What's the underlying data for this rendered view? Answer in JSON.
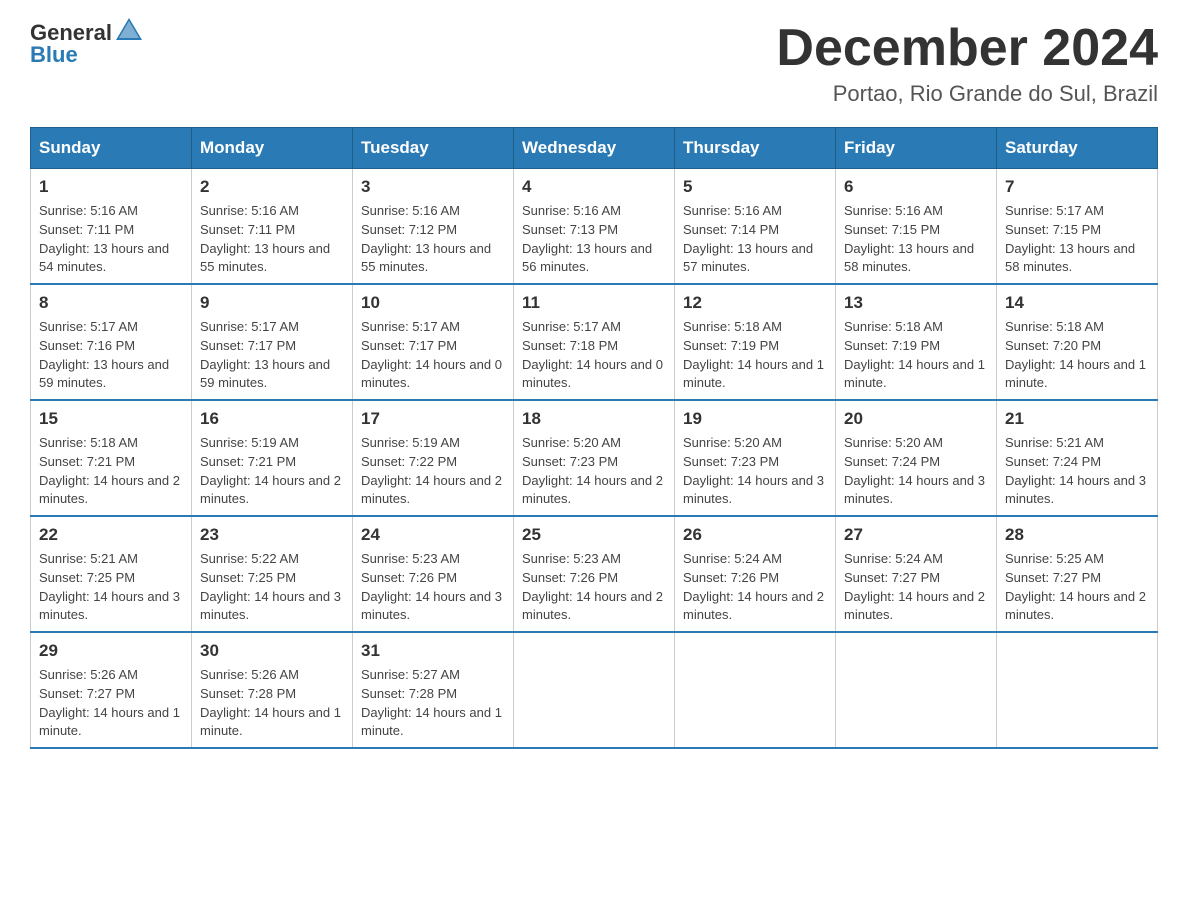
{
  "header": {
    "logo_general": "General",
    "logo_blue": "Blue",
    "title": "December 2024",
    "subtitle": "Portao, Rio Grande do Sul, Brazil"
  },
  "weekdays": [
    "Sunday",
    "Monday",
    "Tuesday",
    "Wednesday",
    "Thursday",
    "Friday",
    "Saturday"
  ],
  "weeks": [
    [
      {
        "day": "1",
        "sunrise": "5:16 AM",
        "sunset": "7:11 PM",
        "daylight": "13 hours and 54 minutes."
      },
      {
        "day": "2",
        "sunrise": "5:16 AM",
        "sunset": "7:11 PM",
        "daylight": "13 hours and 55 minutes."
      },
      {
        "day": "3",
        "sunrise": "5:16 AM",
        "sunset": "7:12 PM",
        "daylight": "13 hours and 55 minutes."
      },
      {
        "day": "4",
        "sunrise": "5:16 AM",
        "sunset": "7:13 PM",
        "daylight": "13 hours and 56 minutes."
      },
      {
        "day": "5",
        "sunrise": "5:16 AM",
        "sunset": "7:14 PM",
        "daylight": "13 hours and 57 minutes."
      },
      {
        "day": "6",
        "sunrise": "5:16 AM",
        "sunset": "7:15 PM",
        "daylight": "13 hours and 58 minutes."
      },
      {
        "day": "7",
        "sunrise": "5:17 AM",
        "sunset": "7:15 PM",
        "daylight": "13 hours and 58 minutes."
      }
    ],
    [
      {
        "day": "8",
        "sunrise": "5:17 AM",
        "sunset": "7:16 PM",
        "daylight": "13 hours and 59 minutes."
      },
      {
        "day": "9",
        "sunrise": "5:17 AM",
        "sunset": "7:17 PM",
        "daylight": "13 hours and 59 minutes."
      },
      {
        "day": "10",
        "sunrise": "5:17 AM",
        "sunset": "7:17 PM",
        "daylight": "14 hours and 0 minutes."
      },
      {
        "day": "11",
        "sunrise": "5:17 AM",
        "sunset": "7:18 PM",
        "daylight": "14 hours and 0 minutes."
      },
      {
        "day": "12",
        "sunrise": "5:18 AM",
        "sunset": "7:19 PM",
        "daylight": "14 hours and 1 minute."
      },
      {
        "day": "13",
        "sunrise": "5:18 AM",
        "sunset": "7:19 PM",
        "daylight": "14 hours and 1 minute."
      },
      {
        "day": "14",
        "sunrise": "5:18 AM",
        "sunset": "7:20 PM",
        "daylight": "14 hours and 1 minute."
      }
    ],
    [
      {
        "day": "15",
        "sunrise": "5:18 AM",
        "sunset": "7:21 PM",
        "daylight": "14 hours and 2 minutes."
      },
      {
        "day": "16",
        "sunrise": "5:19 AM",
        "sunset": "7:21 PM",
        "daylight": "14 hours and 2 minutes."
      },
      {
        "day": "17",
        "sunrise": "5:19 AM",
        "sunset": "7:22 PM",
        "daylight": "14 hours and 2 minutes."
      },
      {
        "day": "18",
        "sunrise": "5:20 AM",
        "sunset": "7:23 PM",
        "daylight": "14 hours and 2 minutes."
      },
      {
        "day": "19",
        "sunrise": "5:20 AM",
        "sunset": "7:23 PM",
        "daylight": "14 hours and 3 minutes."
      },
      {
        "day": "20",
        "sunrise": "5:20 AM",
        "sunset": "7:24 PM",
        "daylight": "14 hours and 3 minutes."
      },
      {
        "day": "21",
        "sunrise": "5:21 AM",
        "sunset": "7:24 PM",
        "daylight": "14 hours and 3 minutes."
      }
    ],
    [
      {
        "day": "22",
        "sunrise": "5:21 AM",
        "sunset": "7:25 PM",
        "daylight": "14 hours and 3 minutes."
      },
      {
        "day": "23",
        "sunrise": "5:22 AM",
        "sunset": "7:25 PM",
        "daylight": "14 hours and 3 minutes."
      },
      {
        "day": "24",
        "sunrise": "5:23 AM",
        "sunset": "7:26 PM",
        "daylight": "14 hours and 3 minutes."
      },
      {
        "day": "25",
        "sunrise": "5:23 AM",
        "sunset": "7:26 PM",
        "daylight": "14 hours and 2 minutes."
      },
      {
        "day": "26",
        "sunrise": "5:24 AM",
        "sunset": "7:26 PM",
        "daylight": "14 hours and 2 minutes."
      },
      {
        "day": "27",
        "sunrise": "5:24 AM",
        "sunset": "7:27 PM",
        "daylight": "14 hours and 2 minutes."
      },
      {
        "day": "28",
        "sunrise": "5:25 AM",
        "sunset": "7:27 PM",
        "daylight": "14 hours and 2 minutes."
      }
    ],
    [
      {
        "day": "29",
        "sunrise": "5:26 AM",
        "sunset": "7:27 PM",
        "daylight": "14 hours and 1 minute."
      },
      {
        "day": "30",
        "sunrise": "5:26 AM",
        "sunset": "7:28 PM",
        "daylight": "14 hours and 1 minute."
      },
      {
        "day": "31",
        "sunrise": "5:27 AM",
        "sunset": "7:28 PM",
        "daylight": "14 hours and 1 minute."
      },
      null,
      null,
      null,
      null
    ]
  ],
  "labels": {
    "sunrise": "Sunrise:",
    "sunset": "Sunset:",
    "daylight": "Daylight:"
  }
}
